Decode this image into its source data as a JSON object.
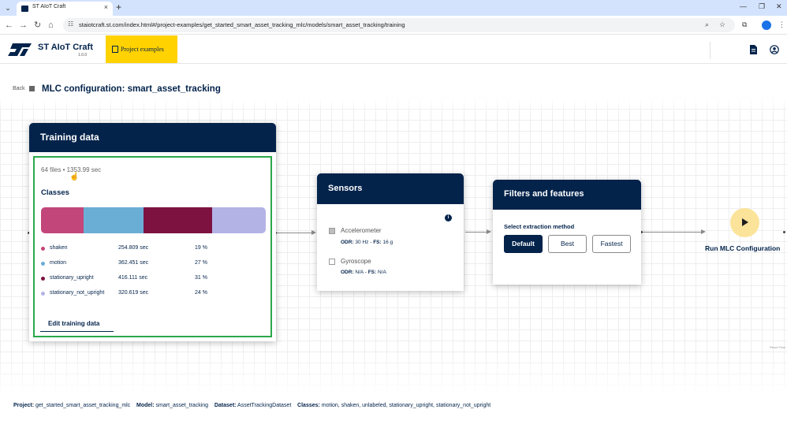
{
  "browser": {
    "tab_title": "ST AIoT Craft",
    "url": "staiotcraft.st.com/index.html#/project-examples/get_started_smart_asset_tracking_mlc/models/smart_asset_tracking/training"
  },
  "app": {
    "name": "ST AIoT Craft",
    "version": "1.0.0",
    "project_examples_label": "Project examples"
  },
  "page": {
    "back_label": "Back",
    "title": "MLC configuration: smart_asset_tracking"
  },
  "training": {
    "title": "Training data",
    "meta": "64 files • 1353.99 sec",
    "classes_title": "Classes",
    "classes": [
      {
        "name": "shaken",
        "duration": "254.809 sec",
        "percent": "19 %",
        "share": 19,
        "color": "#c2467a"
      },
      {
        "name": "motion",
        "duration": "362.451 sec",
        "percent": "27 %",
        "share": 27,
        "color": "#6aaed6"
      },
      {
        "name": "stationary_upright",
        "duration": "416.111 sec",
        "percent": "31 %",
        "share": 31,
        "color": "#7d1240"
      },
      {
        "name": "stationary_not_upright",
        "duration": "320.619 sec",
        "percent": "24 %",
        "share": 24,
        "color": "#b3b3e6"
      }
    ],
    "edit_label": "Edit training data"
  },
  "sensors": {
    "title": "Sensors",
    "items": [
      {
        "name": "Accelerometer",
        "checked": true,
        "odr_label": "ODR:",
        "odr": "30 Hz",
        "fs_label": "FS:",
        "fs": "16 g"
      },
      {
        "name": "Gyroscope",
        "checked": false,
        "odr_label": "ODR:",
        "odr": "N/A",
        "fs_label": "FS:",
        "fs": "N/A"
      }
    ]
  },
  "filters": {
    "title": "Filters and features",
    "method_label": "Select extraction method",
    "methods": [
      "Default",
      "Best",
      "Fastest"
    ],
    "selected": "Default"
  },
  "run": {
    "label": "Run MLC Configuration"
  },
  "attribution": "React Flow",
  "project_bar": {
    "project_label": "Project:",
    "project": "get_started_smart_asset_tracking_mlc",
    "model_label": "Model:",
    "model": "smart_asset_tracking",
    "dataset_label": "Dataset:",
    "dataset": "AssetTrackingDataset",
    "classes_label": "Classes:",
    "classes": "motion, shaken, unlabeled, stationary_upright, stationary_not_upright"
  },
  "colors": {
    "navy": "#03234b",
    "accent_yellow": "#ffd200",
    "selection_green": "#2aa84a",
    "run_button": "#fbe39a"
  }
}
